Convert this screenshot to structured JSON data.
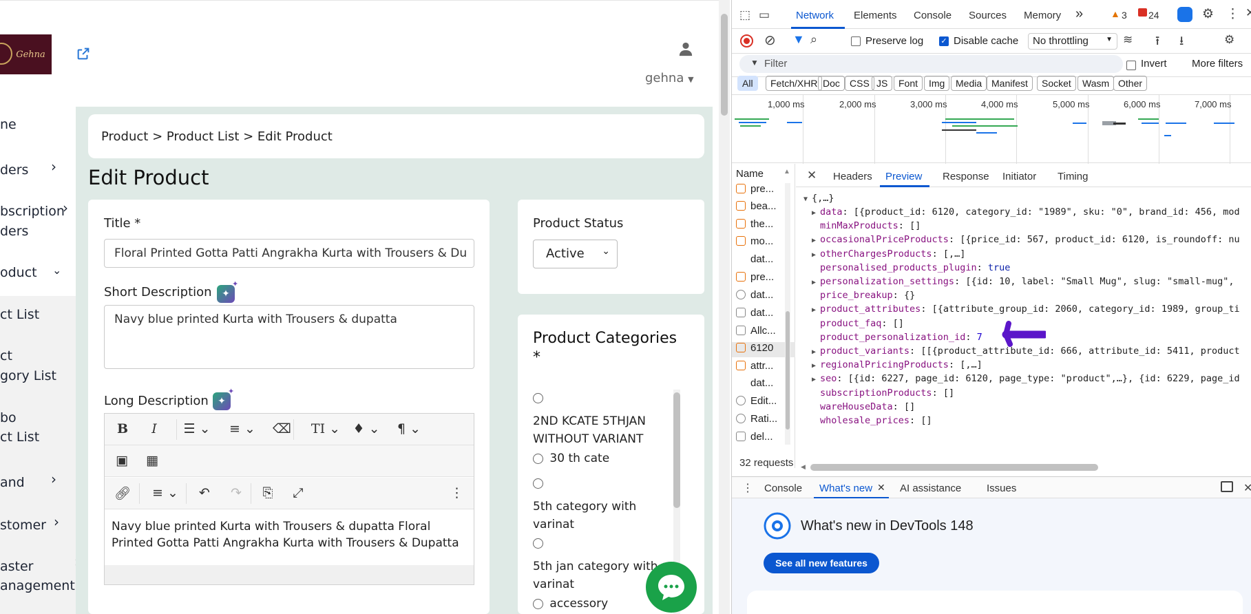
{
  "app": {
    "user_name": "gehna",
    "logo_text": "Gehna",
    "breadcrumb": "Product > Product List > Edit Product",
    "page_title": "Edit Product",
    "nav": [
      {
        "label": "ne"
      },
      {
        "label": "ders"
      },
      {
        "label": "bscription"
      },
      {
        "label": "ders"
      },
      {
        "label": "oduct"
      },
      {
        "label": "ct List"
      },
      {
        "label": "ct"
      },
      {
        "label": "gory List"
      },
      {
        "label": "bo"
      },
      {
        "label": "ct List"
      },
      {
        "label": "and"
      },
      {
        "label": "stomer"
      },
      {
        "label": "aster"
      },
      {
        "label": "anagement"
      }
    ],
    "form": {
      "title_label": "Title *",
      "title_value": "Floral Printed Gotta Patti Angrakha Kurta with Trousers & Du",
      "short_desc_label": "Short Description",
      "short_desc_value": "Navy blue printed Kurta with Trousers & dupatta",
      "long_desc_label": "Long Description",
      "long_desc_line1": "Navy blue printed Kurta with Trousers & dupatta Floral",
      "long_desc_line2": "Printed Gotta Patti Angrakha Kurta with Trousers & Dupatta"
    },
    "status": {
      "label": "Product Status",
      "value": "Active"
    },
    "categories": {
      "title_line1": "Product Categories",
      "title_line2": "*",
      "items": [
        {
          "line1": "2ND KCATE 5THJAN",
          "line2": "WITHOUT VARIANT"
        },
        {
          "line1": "30 th cate",
          "line2": ""
        },
        {
          "line1": "5th category with",
          "line2": "varinat"
        },
        {
          "line1": "5th jan category with",
          "line2": "varinat"
        },
        {
          "line1": "accessory",
          "line2": ""
        }
      ]
    }
  },
  "devtools": {
    "tabs": [
      "Network",
      "Elements",
      "Console",
      "Sources",
      "Memory"
    ],
    "active_tab": "Network",
    "more_tabs": "»",
    "warnings": "3",
    "errors": "24",
    "preserve_log": "Preserve log",
    "disable_cache": "Disable cache",
    "throttling": "No throttling",
    "filter_placeholder": "Filter",
    "invert": "Invert",
    "more_filters": "More filters",
    "type_filters": [
      "All",
      "Fetch/XHR",
      "Doc",
      "CSS",
      "JS",
      "Font",
      "Img",
      "Media",
      "Manifest",
      "Socket",
      "Wasm",
      "Other"
    ],
    "timeline_ticks": [
      "1,000 ms",
      "2,000 ms",
      "3,000 ms",
      "4,000 ms",
      "5,000 ms",
      "6,000 ms",
      "7,000 ms"
    ],
    "name_header": "Name",
    "requests": [
      "pre...",
      "bea...",
      "the...",
      "mo...",
      "dat...",
      "pre...",
      "dat...",
      "dat...",
      "Allc...",
      "6120",
      "attr...",
      "dat...",
      "Edit...",
      "Rati...",
      "del..."
    ],
    "selected_request": "6120",
    "request_count": "32 requests",
    "detail_tabs": [
      "Headers",
      "Preview",
      "Response",
      "Initiator",
      "Timing"
    ],
    "active_detail_tab": "Preview",
    "json_root": "{,…}",
    "json_rows": [
      {
        "key": "data",
        "value": "[{product_id: 6120, category_id: \"1989\", sku: \"0\", brand_id: 456, mod",
        "expandable": true
      },
      {
        "key": "minMaxProducts",
        "value": "[]",
        "expandable": false
      },
      {
        "key": "occasionalPriceProducts",
        "value": "[{price_id: 567, product_id: 6120, is_roundoff: nu",
        "expandable": true
      },
      {
        "key": "otherChargesProducts",
        "value": "[,…]",
        "expandable": true
      },
      {
        "key": "personalised_products_plugin",
        "value": "true",
        "expandable": false
      },
      {
        "key": "personalization_settings",
        "value": "[{id: 10, label: \"Small Mug\", slug: \"small-mug\",",
        "expandable": true
      },
      {
        "key": "price_breakup",
        "value": "{}",
        "expandable": false
      },
      {
        "key": "product_attributes",
        "value": "[{attribute_group_id: 2060, category_id: 1989, group_ti",
        "expandable": true
      },
      {
        "key": "product_faq",
        "value": "[]",
        "expandable": false
      },
      {
        "key": "product_personalization_id",
        "value": "7",
        "expandable": false
      },
      {
        "key": "product_variants",
        "value": "[[{product_attribute_id: 666, attribute_id: 5411, product",
        "expandable": true
      },
      {
        "key": "regionalPricingProducts",
        "value": "[,…]",
        "expandable": true
      },
      {
        "key": "seo",
        "value": "[{id: 6227, page_id: 6120, page_type: \"product\",…}, {id: 6229, page_id",
        "expandable": true
      },
      {
        "key": "subscriptionProducts",
        "value": "[]",
        "expandable": false
      },
      {
        "key": "wareHouseData",
        "value": "[]",
        "expandable": false
      },
      {
        "key": "wholesale_prices",
        "value": "[]",
        "expandable": false
      }
    ],
    "drawer_tabs": [
      "Console",
      "What's new",
      "AI assistance",
      "Issues"
    ],
    "active_drawer_tab": "What's new",
    "whats_new_title": "What's new in DevTools 148",
    "see_all": "See all new features"
  }
}
